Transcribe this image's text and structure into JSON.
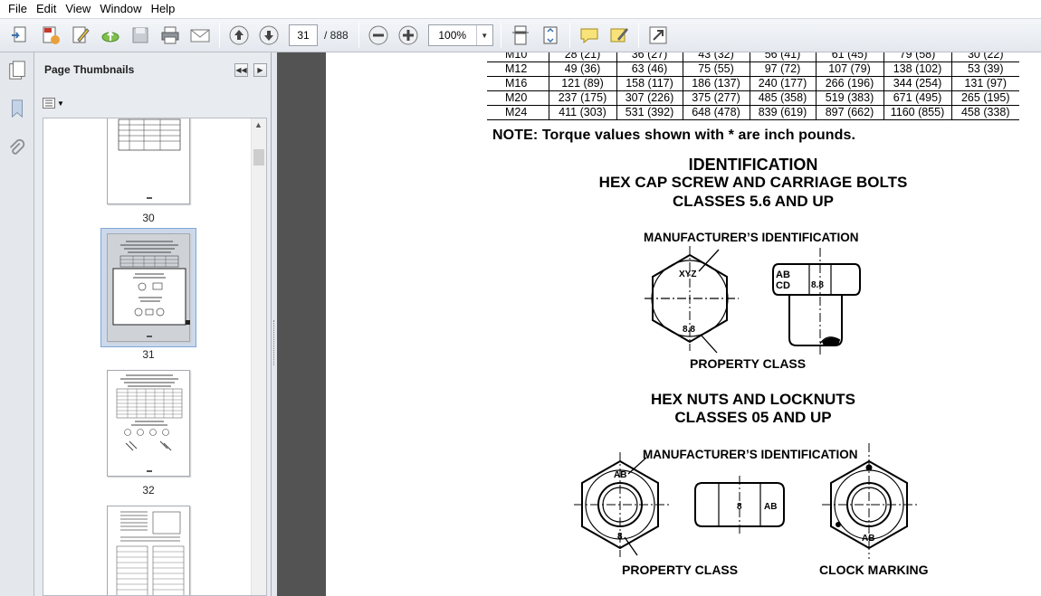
{
  "menu": [
    "File",
    "Edit",
    "View",
    "Window",
    "Help"
  ],
  "toolbar": {
    "current_page": "31",
    "page_total": "/  888",
    "zoom": "100%"
  },
  "nav_panel": {
    "title": "Page Thumbnails",
    "thumbnails": [
      {
        "label": "30"
      },
      {
        "label": "31",
        "selected": true
      },
      {
        "label": "32"
      }
    ]
  },
  "document": {
    "torque_table": {
      "rows": [
        [
          "M10",
          "28 (21)",
          "36 (27)",
          "43 (32)",
          "56 (41)",
          "61 (45)",
          "79 (58)",
          "30 (22)"
        ],
        [
          "M12",
          "49 (36)",
          "63 (46)",
          "75 (55)",
          "97 (72)",
          "107 (79)",
          "138 (102)",
          "53 (39)"
        ],
        [
          "M16",
          "121 (89)",
          "158 (117)",
          "186 (137)",
          "240 (177)",
          "266 (196)",
          "344 (254)",
          "131 (97)"
        ],
        [
          "M20",
          "237 (175)",
          "307 (226)",
          "375 (277)",
          "485 (358)",
          "519 (383)",
          "671 (495)",
          "265 (195)"
        ],
        [
          "M24",
          "411 (303)",
          "531 (392)",
          "648 (478)",
          "839 (619)",
          "897 (662)",
          "1160 (855)",
          "458 (338)"
        ]
      ]
    },
    "note": "NOTE: Torque values shown with * are inch pounds.",
    "identification_title": "IDENTIFICATION",
    "hex_cap_title": "HEX CAP SCREW AND CARRIAGE BOLTS",
    "hex_cap_classes": "CLASSES 5.6 AND UP",
    "manufacturer_id_1": "MANUFACTURER’S IDENTIFICATION",
    "property_class_1": "PROPERTY CLASS",
    "hex_nuts_title": "HEX NUTS AND LOCKNUTS",
    "hex_nuts_classes": "CLASSES 05 AND UP",
    "manufacturer_id_2": "MANUFACTURER’S IDENTIFICATION",
    "property_class_2": "PROPERTY CLASS",
    "clock_marking": "CLOCK MARKING",
    "diagram_marks": {
      "bolt_head_top": "XYZ",
      "bolt_head_bottom": "8.8",
      "bolt_side_mfr_1": "AB",
      "bolt_side_mfr_2": "CD",
      "bolt_side_class": "8.8",
      "nut_top": "AB",
      "nut_bottom": "8",
      "nut_side_class": "8",
      "nut_side_mfr": "AB",
      "locknut_bottom": "AB"
    }
  }
}
